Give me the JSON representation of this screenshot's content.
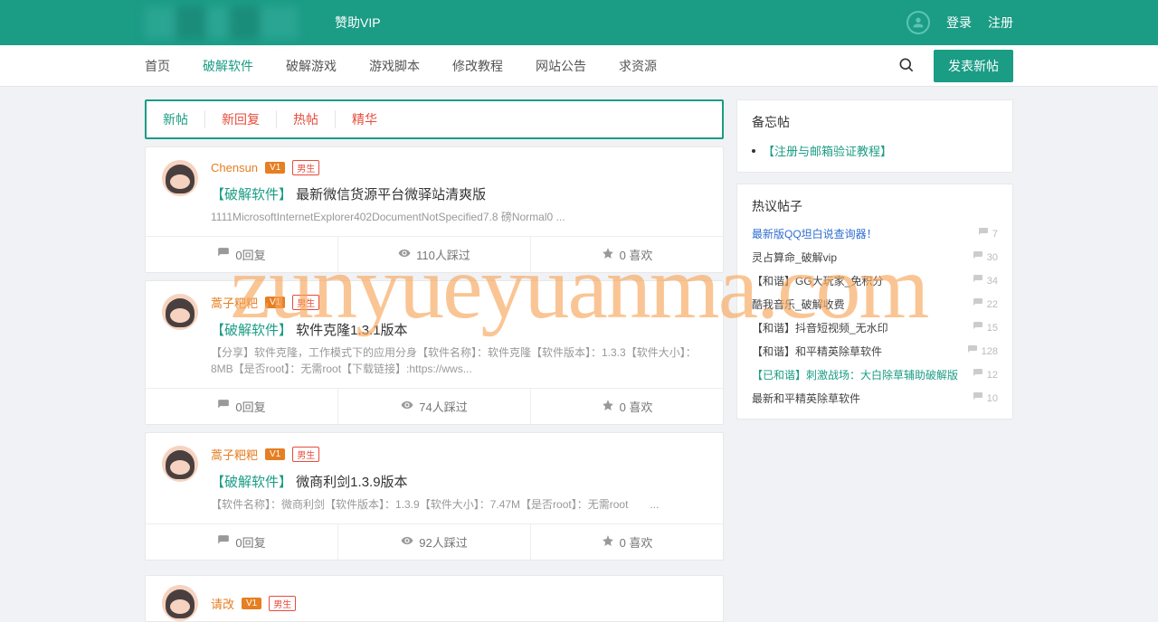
{
  "topbar": {
    "sponsor": "赞助VIP",
    "login": "登录",
    "register": "注册"
  },
  "nav": {
    "items": [
      "首页",
      "破解软件",
      "破解游戏",
      "游戏脚本",
      "修改教程",
      "网站公告",
      "求资源"
    ],
    "active_index": 1,
    "post_button": "发表新帖"
  },
  "tabs": [
    "新帖",
    "新回复",
    "热帖",
    "精华"
  ],
  "posts": [
    {
      "author": "Chensun",
      "level": "V1",
      "gender": "男生",
      "category": "【破解软件】",
      "title": "最新微信货源平台微驿站清爽版",
      "excerpt": "1111MicrosoftInternetExplorer402DocumentNotSpecified7.8 磅Normal0 ...",
      "replies": "0回复",
      "views": "110人踩过",
      "likes": "0 喜欢"
    },
    {
      "author": "蒿子粑粑",
      "level": "V1",
      "gender": "男生",
      "category": "【破解软件】",
      "title": "软件克隆1.3.1版本",
      "excerpt": "【分享】软件克隆，工作模式下的应用分身【软件名称】：软件克隆【软件版本】：1.3.3【软件大小】：8MB【是否root】：无需root【下载链接】:https://wws...",
      "replies": "0回复",
      "views": "74人踩过",
      "likes": "0 喜欢"
    },
    {
      "author": "蒿子粑粑",
      "level": "V1",
      "gender": "男生",
      "category": "【破解软件】",
      "title": "微商利剑1.3.9版本",
      "excerpt": "【软件名称】：微商利剑【软件版本】：1.3.9【软件大小】：7.47M【是否root】：无需root　　...",
      "replies": "0回复",
      "views": "92人踩过",
      "likes": "0 喜欢"
    }
  ],
  "partial_post": {
    "author": "请改",
    "level": "V1",
    "gender": "男生"
  },
  "sidebar": {
    "memo_title": "备忘帖",
    "memo_item": "【注册与邮箱验证教程】",
    "hot_title": "热议帖子",
    "hot": [
      {
        "title": "最新版QQ坦白说查询器！",
        "count": "7",
        "color": "blue"
      },
      {
        "title": "灵占算命_破解vip",
        "count": "30",
        "color": "dark"
      },
      {
        "title": "【和谐】GG大玩家_免积分",
        "count": "34",
        "color": "dark"
      },
      {
        "title": "酷我音乐_破解收费",
        "count": "22",
        "color": "dark"
      },
      {
        "title": "【和谐】抖音短视频_无水印",
        "count": "15",
        "color": "dark"
      },
      {
        "title": "【和谐】和平精英除草软件",
        "count": "128",
        "color": "dark"
      },
      {
        "title": "【已和谐】刺激战场：大白除草辅助破解版",
        "count": "12",
        "color": "green"
      },
      {
        "title": "最新和平精英除草软件",
        "count": "10",
        "color": "dark"
      }
    ]
  },
  "watermark": "zunyueyuanma.com"
}
